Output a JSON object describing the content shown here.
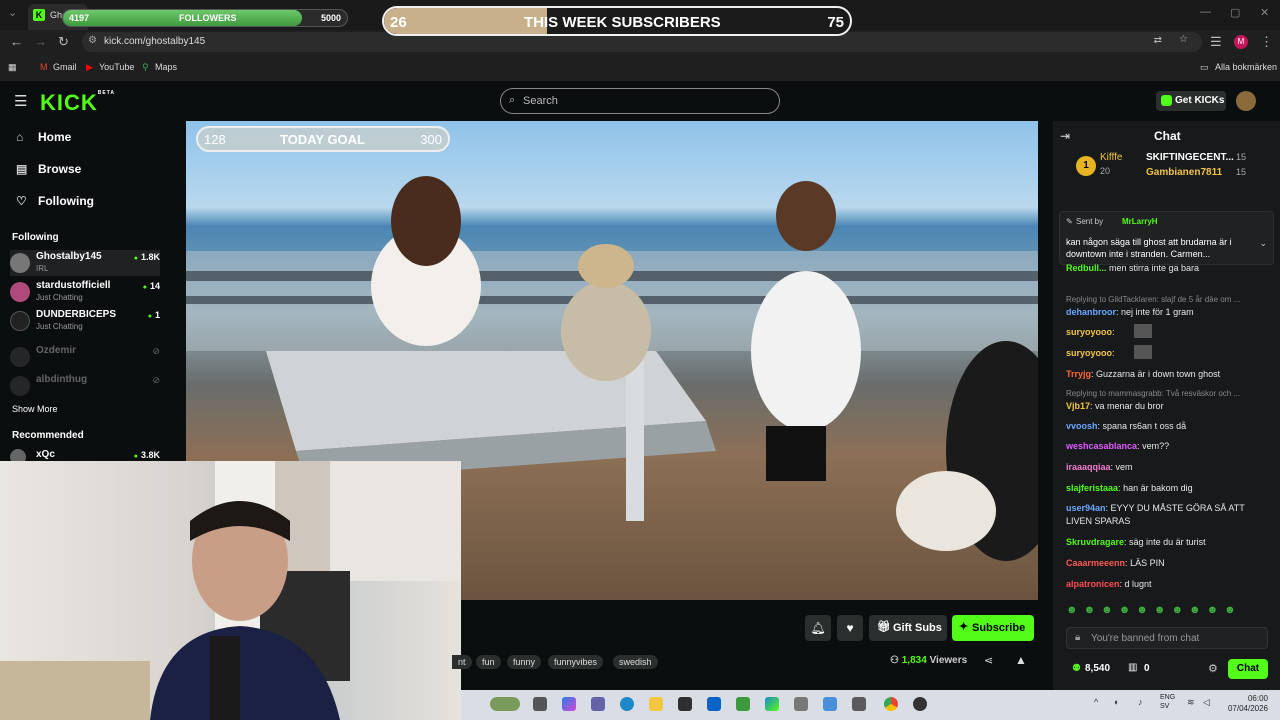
{
  "browser": {
    "tab_title": "Ghost",
    "url": "kick.com/ghostalby145",
    "profile_initial": "M",
    "bookmarks": [
      "Gmail",
      "YouTube",
      "Maps"
    ],
    "all_bookmarks": "Alla bokmärken"
  },
  "overlays": {
    "followers_goal": {
      "current": "4197",
      "label": "FOLLOWERS",
      "target": "5000",
      "fraction": 0.84
    },
    "subs_goal": {
      "current": "26",
      "label": "THIS WEEK SUBSCRIBERS",
      "target": "75",
      "fraction": 0.35
    },
    "today_goal": {
      "current": "128",
      "label": "TODAY GOAL",
      "target": "300"
    }
  },
  "header": {
    "logo": "KICK",
    "logo_badge": "BETA",
    "search_placeholder": "Search",
    "get_kicks": "Get KICKs"
  },
  "sidebar": {
    "nav": [
      {
        "label": "Home",
        "icon": "home-icon"
      },
      {
        "label": "Browse",
        "icon": "browse-icon"
      },
      {
        "label": "Following",
        "icon": "heart-icon"
      }
    ],
    "following_title": "Following",
    "following": [
      {
        "name": "Ghostalby145",
        "category": "IRL",
        "viewers": "1.8K"
      },
      {
        "name": "stardustofficiell",
        "category": "Just Chatting",
        "viewers": "14"
      },
      {
        "name": "DUNDERBICEPS",
        "category": "Just Chatting",
        "viewers": "1"
      },
      {
        "name": "Ozdemir",
        "category": "",
        "viewers": ""
      },
      {
        "name": "albdinthug",
        "category": "",
        "viewers": ""
      }
    ],
    "show_more": "Show More",
    "recommended_title": "Recommended",
    "recommended": [
      {
        "name": "xQc",
        "viewers": "3.8K"
      }
    ]
  },
  "stream": {
    "gift_subs": "Gift Subs",
    "subscribe": "Subscribe",
    "tags": [
      "nt",
      "fun",
      "funny",
      "funnyvibes",
      "swedish"
    ],
    "viewers": "1,834",
    "viewers_label": "Viewers"
  },
  "chat": {
    "title": "Chat",
    "leaderboard": [
      {
        "rank": "1",
        "name": "Kifffe",
        "count": "20"
      },
      {
        "name": "SKIFTINGECENT...",
        "count": "15"
      },
      {
        "name": "Gambianen7811",
        "count": "15"
      }
    ],
    "pinned_by_label": "Sent by",
    "pinned_by": "MrLarryH",
    "pinned_text": "kan någon säga till ghost att brudarna är i downtown inte i stranden. Carmen...",
    "messages": [
      {
        "reply": "",
        "user": "Redbull...",
        "text": "men stirra inte ga bara",
        "color": "#53fc18"
      },
      {
        "reply": "Replying to GildTacklaren: slajf de 5 år däe om ...",
        "user": "dehanbroor",
        "text": "nej inte för 1 gram",
        "color": "#6aa8ff"
      },
      {
        "reply": "",
        "user": "suryoyooo",
        "text": "",
        "color": "#f5c542"
      },
      {
        "reply": "",
        "user": "suryoyooo",
        "text": "",
        "color": "#f5c542"
      },
      {
        "reply": "",
        "user": "Trryjg",
        "text": "Guzzarna är i down town ghost",
        "color": "#ff6a3d"
      },
      {
        "reply": "Replying to mammasgrabb: Två resväskor och ...",
        "user": "Vjb17",
        "text": "va menar du bror",
        "color": "#f5c542"
      },
      {
        "reply": "",
        "user": "vvoosh",
        "text": "spana rs6an t oss då",
        "color": "#6aa8ff"
      },
      {
        "reply": "",
        "user": "weshcasablanca",
        "text": "vem??",
        "color": "#e15cff"
      },
      {
        "reply": "",
        "user": "iraaaqqiaa",
        "text": "vem",
        "color": "#f57dd0"
      },
      {
        "reply": "",
        "user": "slajferistaaa",
        "text": "han är bakom dig",
        "color": "#53fc18"
      },
      {
        "reply": "",
        "user": "user94an",
        "text": "EYYY DU MÅSTE GÖRA SÅ ATT LIVEN SPARAS",
        "color": "#6aa8ff"
      },
      {
        "reply": "",
        "user": "Skruvdragare",
        "text": "säg inte du är turist",
        "color": "#53fc18"
      },
      {
        "reply": "",
        "user": "Caaarmeeenn",
        "text": "LÄS PIN",
        "color": "#ff5a5a"
      },
      {
        "reply": "",
        "user": "alpatronicen",
        "text": "d lugnt",
        "color": "#ff4d4d"
      }
    ],
    "banned_text": "You're banned from chat",
    "points": "8,540",
    "gifts": "0",
    "chat_button": "Chat"
  },
  "taskbar": {
    "lang": "ENG",
    "region": "SV",
    "time": "06:00",
    "date": "07/04/2026"
  }
}
